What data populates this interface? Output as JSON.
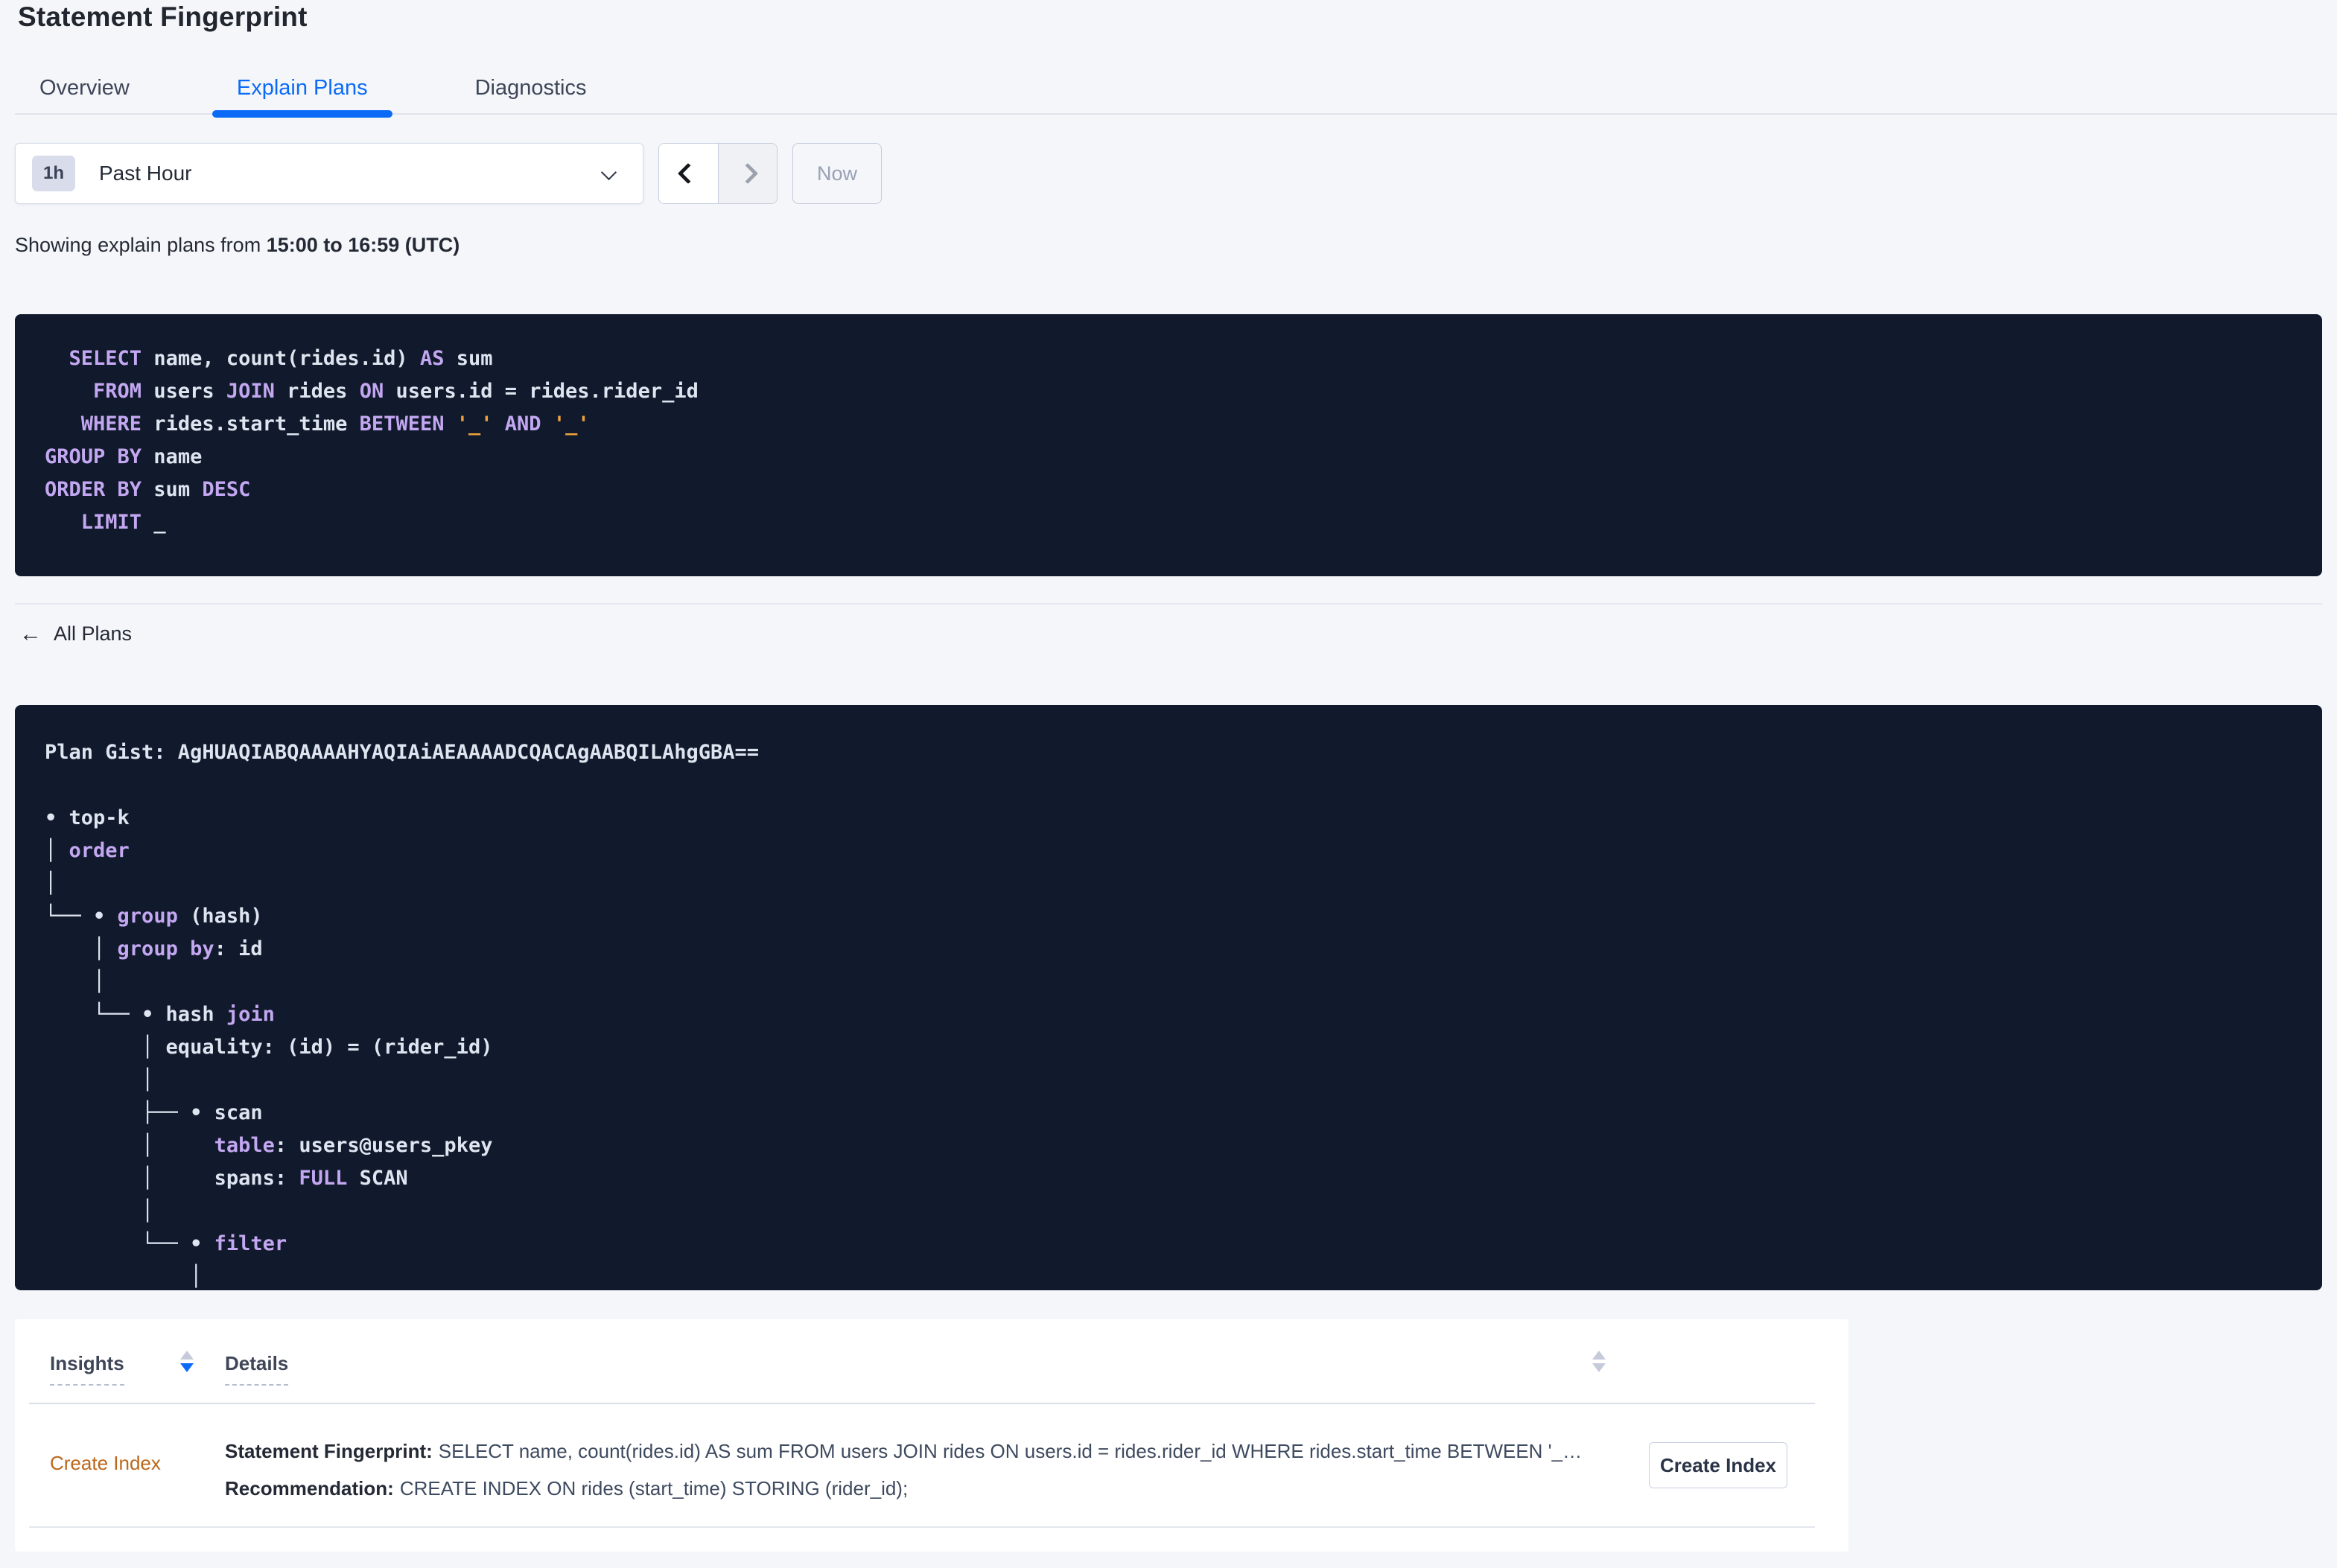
{
  "page": {
    "title": "Statement Fingerprint"
  },
  "tabs": [
    {
      "label": "Overview"
    },
    {
      "label": "Explain Plans"
    },
    {
      "label": "Diagnostics"
    }
  ],
  "active_tab": "Explain Plans",
  "time_picker": {
    "badge": "1h",
    "label": "Past Hour",
    "now_label": "Now"
  },
  "showing": {
    "prefix": "Showing explain plans from ",
    "range": "15:00 to 16:59 (UTC)"
  },
  "sql_block": {
    "lines": [
      [
        {
          "c": "plain",
          "t": "  "
        },
        {
          "c": "kw",
          "t": "SELECT"
        },
        {
          "c": "plain",
          "t": " name, count(rides.id) "
        },
        {
          "c": "kw",
          "t": "AS"
        },
        {
          "c": "plain",
          "t": " sum"
        }
      ],
      [
        {
          "c": "plain",
          "t": "    "
        },
        {
          "c": "kw",
          "t": "FROM"
        },
        {
          "c": "plain",
          "t": " users "
        },
        {
          "c": "kw",
          "t": "JOIN"
        },
        {
          "c": "plain",
          "t": " rides "
        },
        {
          "c": "kw",
          "t": "ON"
        },
        {
          "c": "plain",
          "t": " users.id = rides.rider_id"
        }
      ],
      [
        {
          "c": "plain",
          "t": "   "
        },
        {
          "c": "kw",
          "t": "WHERE"
        },
        {
          "c": "plain",
          "t": " rides.start_time "
        },
        {
          "c": "kw",
          "t": "BETWEEN"
        },
        {
          "c": "plain",
          "t": " "
        },
        {
          "c": "lit",
          "t": "'_'"
        },
        {
          "c": "plain",
          "t": " "
        },
        {
          "c": "kw",
          "t": "AND"
        },
        {
          "c": "plain",
          "t": " "
        },
        {
          "c": "lit",
          "t": "'_'"
        }
      ],
      [
        {
          "c": "kw",
          "t": "GROUP BY"
        },
        {
          "c": "plain",
          "t": " name"
        }
      ],
      [
        {
          "c": "kw",
          "t": "ORDER BY"
        },
        {
          "c": "plain",
          "t": " sum "
        },
        {
          "c": "kw",
          "t": "DESC"
        }
      ],
      [
        {
          "c": "plain",
          "t": "   "
        },
        {
          "c": "kw",
          "t": "LIMIT"
        },
        {
          "c": "plain",
          "t": " _"
        }
      ]
    ]
  },
  "all_plans": {
    "label": "All Plans",
    "arrow": "←"
  },
  "plan_block": {
    "gist": "AgHUAQIABQAAAAHYAQIAiAEAAAADCQACAgAABQILAhgGBA==",
    "lines": [
      [
        {
          "c": "plain",
          "t": "Plan Gist: AgHUAQIABQAAAAHYAQIAiAEAAAADCQACAgAABQILAhgGBA=="
        }
      ],
      [],
      [
        {
          "c": "plain",
          "t": "• top-k"
        }
      ],
      [
        {
          "c": "plain",
          "t": "│ "
        },
        {
          "c": "kw",
          "t": "order"
        }
      ],
      [
        {
          "c": "plain",
          "t": "│"
        }
      ],
      [
        {
          "c": "plain",
          "t": "└── • "
        },
        {
          "c": "kw",
          "t": "group"
        },
        {
          "c": "plain",
          "t": " (hash)"
        }
      ],
      [
        {
          "c": "plain",
          "t": "    │ "
        },
        {
          "c": "kw",
          "t": "group by"
        },
        {
          "c": "plain",
          "t": ": id"
        }
      ],
      [
        {
          "c": "plain",
          "t": "    │"
        }
      ],
      [
        {
          "c": "plain",
          "t": "    └── • hash "
        },
        {
          "c": "kw",
          "t": "join"
        }
      ],
      [
        {
          "c": "plain",
          "t": "        │ equality: (id) = (rider_id)"
        }
      ],
      [
        {
          "c": "plain",
          "t": "        │"
        }
      ],
      [
        {
          "c": "plain",
          "t": "        ├── • scan"
        }
      ],
      [
        {
          "c": "plain",
          "t": "        │     "
        },
        {
          "c": "kw",
          "t": "table"
        },
        {
          "c": "plain",
          "t": ": users@users_pkey"
        }
      ],
      [
        {
          "c": "plain",
          "t": "        │     spans: "
        },
        {
          "c": "kw",
          "t": "FULL"
        },
        {
          "c": "plain",
          "t": " SCAN"
        }
      ],
      [
        {
          "c": "plain",
          "t": "        │"
        }
      ],
      [
        {
          "c": "plain",
          "t": "        └── • "
        },
        {
          "c": "kw",
          "t": "filter"
        }
      ],
      [
        {
          "c": "plain",
          "t": "            │"
        }
      ]
    ]
  },
  "insights_table": {
    "headers": [
      {
        "label": "Insights"
      },
      {
        "label": "Details"
      }
    ],
    "row": {
      "insight": "Create Index",
      "fingerprint_label": "Statement Fingerprint:",
      "fingerprint": "SELECT name, count(rides.id) AS sum FROM users JOIN rides ON users.id = rides.rider_id WHERE rides.start_time BETWEEN '_…",
      "recommendation_label": "Recommendation:",
      "recommendation": "CREATE INDEX ON rides (start_time) STORING (rider_id);",
      "action_label": "Create Index"
    }
  },
  "colors": {
    "page_bg": "#f4f6fa",
    "accent_blue": "#0b6bf7",
    "insight_link_orange": "#bc671c",
    "code_bg": "#111a2c",
    "code_text": "#dfe5f0",
    "code_keyword": "#c3a7f1",
    "code_literal": "#f0a23c"
  }
}
